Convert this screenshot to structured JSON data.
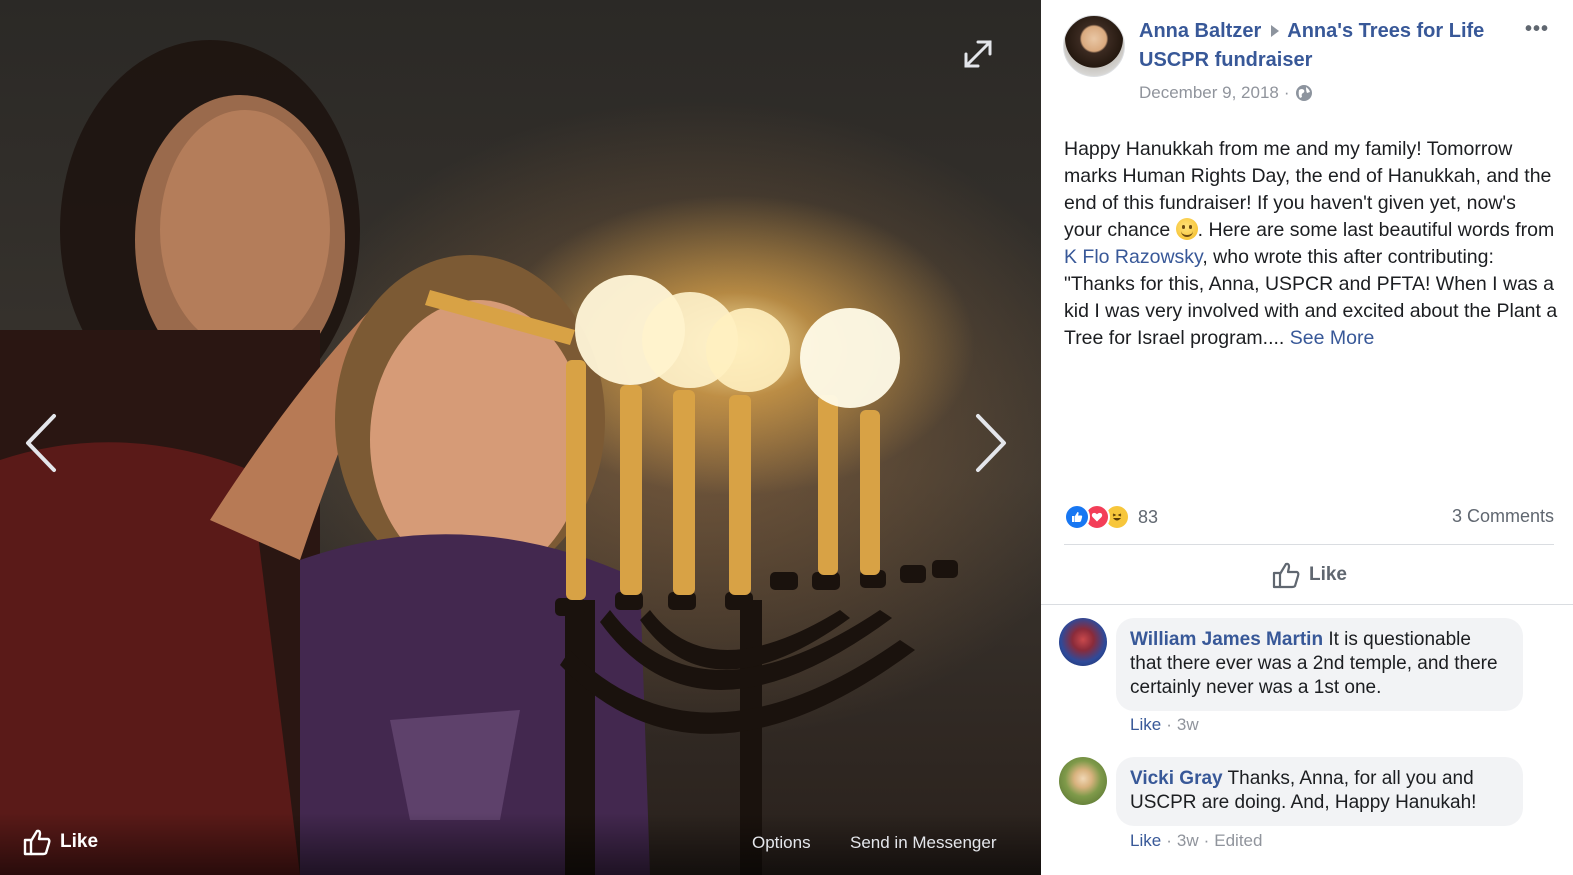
{
  "viewer": {
    "footer": {
      "like_label": "Like",
      "options_label": "Options",
      "messenger_label": "Send in Messenger"
    }
  },
  "post": {
    "author": "Anna Baltzer",
    "target": "Anna's Trees for Life USCPR fundraiser",
    "date": "December 9, 2018",
    "sep": "·",
    "text_1": "Happy Hanukkah from me and my family! Tomorrow marks Human Rights Day, the end of Hanukkah, and the end of this fundraiser! If you haven't given yet, now's your chance ",
    "text_2": ". Here are some last beautiful words from ",
    "mention": "K Flo Razowsky",
    "text_3": ", who wrote this after contributing:",
    "quote": "\"Thanks for this, Anna, USPCR and PFTA! When I was a kid I was very involved with and excited about the Plant a Tree for Israel program.... ",
    "see_more": "See More",
    "reaction_count": "83",
    "comments_count": "3 Comments",
    "like_label": "Like",
    "more_label": "•••"
  },
  "comments": [
    {
      "author": "William James Martin",
      "text": " It is questionable that there ever was a 2nd temple, and there certainly never was a 1st one.",
      "like": "Like",
      "dot": "·",
      "time": "3w"
    },
    {
      "author": "Vicki Gray",
      "text": " Thanks, Anna, for all you and USCPR are doing. And, Happy Hanukah!",
      "like": "Like",
      "dot": "·",
      "time": "3w",
      "edited": "Edited"
    }
  ],
  "icons": {
    "expand": "expand-icon",
    "prev": "chevron-left-icon",
    "next": "chevron-right-icon",
    "like": "thumbs-up-icon",
    "globe": "globe-icon",
    "reactions": [
      "like-reaction-icon",
      "love-reaction-icon",
      "haha-reaction-icon"
    ]
  },
  "colors": {
    "link": "#385898",
    "like_blue": "#1877f2",
    "love_red": "#f33e58",
    "haha_yellow": "#f7c63b",
    "muted": "#90949c"
  }
}
